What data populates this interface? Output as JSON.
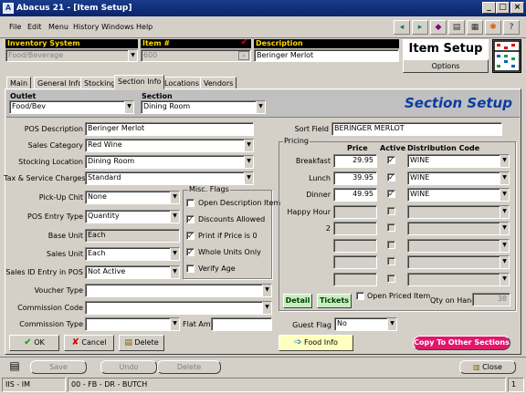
{
  "window": {
    "title": "Abacus 21 - [Item Setup]",
    "icon": "abacus-icon"
  },
  "menu": [
    "File",
    "Edit",
    "Menu",
    "History",
    "Windows",
    "Help"
  ],
  "toolbar": {
    "icons": [
      "arrow-left-icon",
      "arrow-right-icon",
      "eraser-icon",
      "print-icon",
      "calculator-icon",
      "runner-icon",
      "help-icon"
    ]
  },
  "header": {
    "inventory_system_label": "Inventory System",
    "inventory_system_value": "Food/Beverage",
    "item_label": "Item #",
    "item_value": "600",
    "description_label": "Description",
    "description_value": "Beringer Merlot",
    "brand_title": "Item Setup",
    "options_label": "Options"
  },
  "tabs": [
    "Main",
    "General Info",
    "Stocking",
    "Section Info",
    "Locations",
    "Vendors"
  ],
  "section": {
    "outlet_label": "Outlet",
    "outlet_value": "Food/Bev",
    "section_label": "Section",
    "section_value": "Dining Room",
    "banner": "Section Setup"
  },
  "form": {
    "pos_description_label": "POS Description",
    "pos_description_value": "Beringer Merlot",
    "sales_category_label": "Sales Category",
    "sales_category_value": "Red Wine",
    "stocking_location_label": "Stocking Location",
    "stocking_location_value": "Dining Room",
    "tax_label": "Tax & Service Charges",
    "tax_value": "Standard",
    "pickup_label": "Pick-Up Chit",
    "pickup_value": "None",
    "entry_type_label": "POS Entry Type",
    "entry_type_value": "Quantity",
    "base_unit_label": "Base Unit",
    "base_unit_value": "Each",
    "sales_unit_label": "Sales Unit",
    "sales_unit_value": "Each",
    "sales_id_label": "Sales ID Entry in POS",
    "sales_id_value": "Not Active",
    "voucher_label": "Voucher Type",
    "voucher_value": "",
    "commission_code_label": "Commission Code",
    "commission_code_value": "",
    "commission_type_label": "Commission Type",
    "commission_type_value": "",
    "flat_amt_label": "Flat Amt",
    "flat_amt_value": ""
  },
  "misc_flags": {
    "title": "Misc. Flags",
    "items": [
      {
        "label": "Open Description Item",
        "checked": ""
      },
      {
        "label": "Discounts Allowed",
        "checked": "✓"
      },
      {
        "label": "Print if Price is 0",
        "checked": "✓"
      },
      {
        "label": "Whole Units Only",
        "checked": "✓"
      },
      {
        "label": "Verify Age",
        "checked": ""
      }
    ]
  },
  "sort_field": {
    "label": "Sort Field",
    "value": "BERINGER MERLOT"
  },
  "pricing": {
    "title": "Pricing",
    "col_price": "Price",
    "col_active": "Active",
    "col_dist": "Distribution Code",
    "rows": [
      {
        "label": "Breakfast",
        "price": "29.95",
        "active": "✓",
        "dist": "WINE"
      },
      {
        "label": "Lunch",
        "price": "39.95",
        "active": "✓",
        "dist": "WINE"
      },
      {
        "label": "Dinner",
        "price": "49.95",
        "active": "✓",
        "dist": "WINE"
      },
      {
        "label": "Happy Hour",
        "price": "",
        "active": "",
        "dist": ""
      },
      {
        "label": "2",
        "price": "",
        "active": "",
        "dist": ""
      },
      {
        "label": "",
        "price": "",
        "active": "",
        "dist": ""
      },
      {
        "label": "",
        "price": "",
        "active": "",
        "dist": ""
      },
      {
        "label": "",
        "price": "",
        "active": "",
        "dist": ""
      }
    ],
    "detail_btn": "Detail",
    "tickets_btn": "Tickets",
    "open_priced_label": "Open Priced Item",
    "qty_label": "Qty on Hand",
    "qty_value": "38"
  },
  "guest_flag": {
    "label": "Guest Flag",
    "value": "No"
  },
  "buttons": {
    "ok": "OK",
    "cancel": "Cancel",
    "delete": "Delete",
    "food_info": "Food Info",
    "copy_sections": "Copy To Other Sections",
    "save": "Save",
    "undo": "Undo",
    "delete_bottom": "Delete",
    "close": "Close"
  },
  "statusbar": {
    "left": "IIS - IM",
    "mid": "00 - FB - DR - BUTCH",
    "right": "1"
  },
  "colors": {
    "accent_blue": "#0a246a",
    "header_yellow": "#ffd800",
    "banner_blue": "#0a3ca0",
    "copy_pink": "#e0186c",
    "info_bg": "#c8ecc0"
  }
}
